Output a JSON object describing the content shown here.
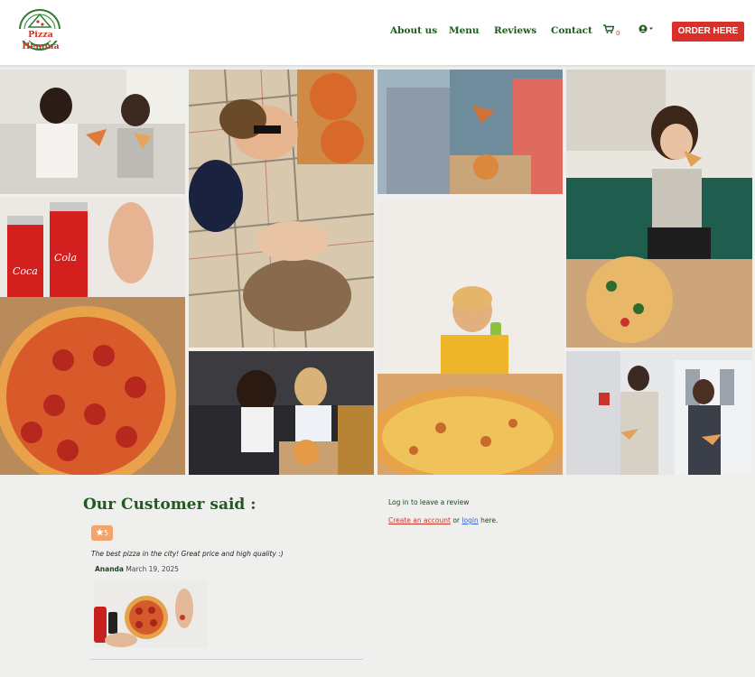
{
  "brand": {
    "name": "Pizza Hemma",
    "accent": "#d9302a",
    "green": "#1f5b1f"
  },
  "nav": {
    "items": [
      "About us",
      "Menu",
      "Reviews",
      "Contact"
    ],
    "cart_icon": "shopping-cart-icon",
    "cart_count": "0",
    "user_icon": "user-circle-icon",
    "order_label": "ORDER HERE"
  },
  "gallery": {
    "photos": [
      "two friends eating pizza on sofa",
      "couple lying on picnic blanket with pizza",
      "friends sharing pizza by the water",
      "woman eating pizza on green sofa",
      "coca-cola cans with pepperoni pizza",
      "boy drinking beside a large pizza",
      "two friends eating pizza on floor",
      "couple walking on street eating pizza"
    ]
  },
  "reviews": {
    "title": "Our Customer said :",
    "rating_icon": "star-icon",
    "items": [
      {
        "rating": "5",
        "text": "The best pizza in the city! Great price and high quality :)",
        "author": "Ananda",
        "date": "March 19, 2025"
      }
    ],
    "login_prompt": "Log in to leave a review",
    "create_account_label": "Create an account",
    "or_text": "or",
    "login_label": "login",
    "here_text": "here."
  }
}
